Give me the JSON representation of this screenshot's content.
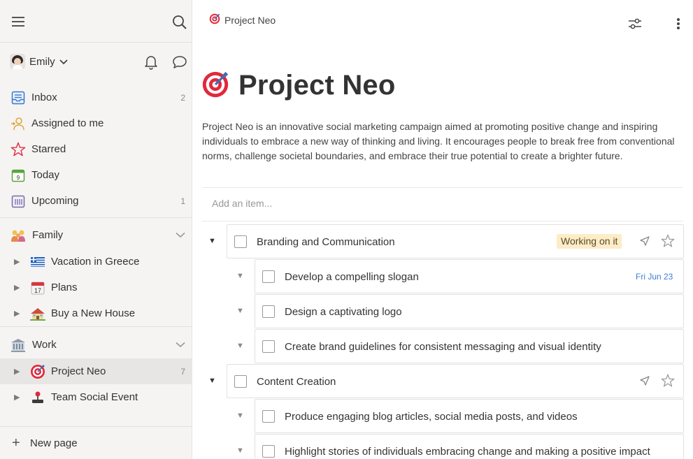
{
  "sidebar": {
    "menu_icon": "hamburger-menu-icon",
    "search_icon": "search-icon",
    "user": {
      "name": "Emily"
    },
    "nav": [
      {
        "label": "Inbox",
        "count": "2",
        "icon": "inbox-icon"
      },
      {
        "label": "Assigned to me",
        "count": "",
        "icon": "assigned-user-icon"
      },
      {
        "label": "Starred",
        "count": "",
        "icon": "star-icon"
      },
      {
        "label": "Today",
        "count": "",
        "icon": "calendar-today-icon",
        "day": "9"
      },
      {
        "label": "Upcoming",
        "count": "1",
        "icon": "calendar-upcoming-icon"
      }
    ],
    "groups": [
      {
        "label": "Family",
        "icon": "family-icon",
        "items": [
          {
            "label": "Vacation in Greece",
            "icon": "greece-flag-icon",
            "count": ""
          },
          {
            "label": "Plans",
            "icon": "calendar-icon",
            "count": ""
          },
          {
            "label": "Buy a New House",
            "icon": "house-icon",
            "count": ""
          }
        ]
      },
      {
        "label": "Work",
        "icon": "office-building-icon",
        "items": [
          {
            "label": "Project Neo",
            "icon": "target-icon",
            "count": "7"
          },
          {
            "label": "Team Social Event",
            "icon": "joystick-icon",
            "count": ""
          }
        ]
      }
    ],
    "new_page_label": "New page"
  },
  "main": {
    "breadcrumb": "Project Neo",
    "title": "Project Neo",
    "description": "Project Neo is an innovative social marketing campaign aimed at promoting positive change and inspiring individuals to embrace a new way of thinking and living. It encourages people to break free from conventional norms, challenge societal boundaries, and embrace their true potential to create a brighter future.",
    "add_placeholder": "Add an item...",
    "tasks": [
      {
        "label": "Branding and Communication",
        "status": "Working on it",
        "due": ""
      },
      {
        "label": "Develop a compelling slogan",
        "due": "Fri Jun 23"
      },
      {
        "label": "Design a captivating logo",
        "due": ""
      },
      {
        "label": "Create brand guidelines for consistent messaging and visual identity",
        "due": ""
      },
      {
        "label": "Content Creation",
        "status": "",
        "due": ""
      },
      {
        "label": "Produce engaging blog articles, social media posts, and videos",
        "due": ""
      },
      {
        "label": "Highlight stories of individuals embracing change and making a positive impact",
        "due": ""
      }
    ]
  },
  "colors": {
    "sidebar_bg": "#f5f4f3",
    "status_badge_bg": "#fcecc8",
    "due_date": "#3b7dd8",
    "target_red": "#e0293b"
  }
}
